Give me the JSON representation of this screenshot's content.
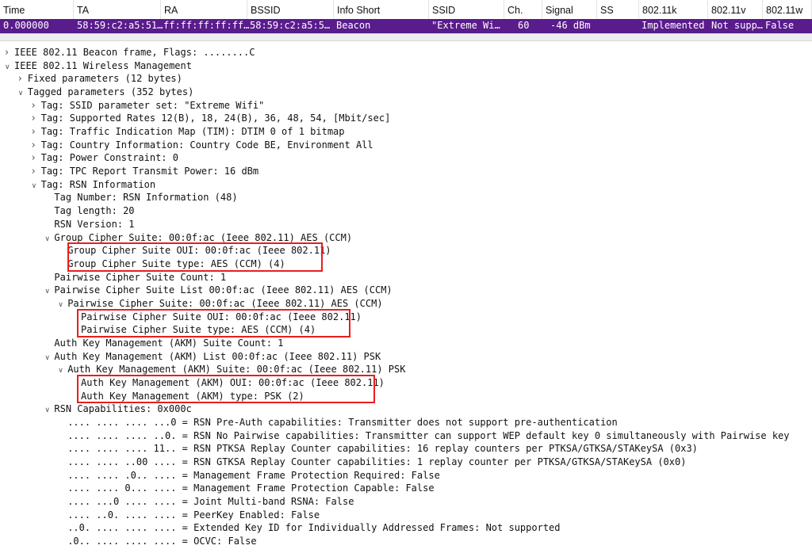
{
  "packet_list": {
    "columns": [
      "Time",
      "TA",
      "RA",
      "BSSID",
      "Info Short",
      "SSID",
      "Ch.",
      "Signal",
      "SS",
      "802.11k",
      "802.11v",
      "802.11w"
    ],
    "selected_row": [
      "0.000000",
      "58:59:c2:a5:51…",
      "ff:ff:ff:ff:ff…",
      "58:59:c2:a5:5…",
      "Beacon",
      "\"Extreme Wi…",
      "60",
      "-46 dBm",
      "",
      "Implemented",
      "Not supp…",
      "False"
    ],
    "selected_color": "#5a1b8d"
  },
  "tree": [
    {
      "level": 0,
      "arrow": "collapsed",
      "text": "IEEE 802.11 Beacon frame, Flags: ........C"
    },
    {
      "level": 0,
      "arrow": "expanded",
      "text": "IEEE 802.11 Wireless Management"
    },
    {
      "level": 1,
      "arrow": "collapsed",
      "text": "Fixed parameters (12 bytes)"
    },
    {
      "level": 1,
      "arrow": "expanded",
      "text": "Tagged parameters (352 bytes)"
    },
    {
      "level": 2,
      "arrow": "collapsed",
      "text": "Tag: SSID parameter set: \"Extreme Wifi\""
    },
    {
      "level": 2,
      "arrow": "collapsed",
      "text": "Tag: Supported Rates 12(B), 18, 24(B), 36, 48, 54, [Mbit/sec]"
    },
    {
      "level": 2,
      "arrow": "collapsed",
      "text": "Tag: Traffic Indication Map (TIM): DTIM 0 of 1 bitmap"
    },
    {
      "level": 2,
      "arrow": "collapsed",
      "text": "Tag: Country Information: Country Code BE, Environment All"
    },
    {
      "level": 2,
      "arrow": "collapsed",
      "text": "Tag: Power Constraint: 0"
    },
    {
      "level": 2,
      "arrow": "collapsed",
      "text": "Tag: TPC Report Transmit Power: 16 dBm"
    },
    {
      "level": 2,
      "arrow": "expanded",
      "text": "Tag: RSN Information"
    },
    {
      "level": 3,
      "arrow": "none",
      "text": "Tag Number: RSN Information (48)"
    },
    {
      "level": 3,
      "arrow": "none",
      "text": "Tag length: 20"
    },
    {
      "level": 3,
      "arrow": "none",
      "text": "RSN Version: 1"
    },
    {
      "level": 3,
      "arrow": "expanded",
      "text": "Group Cipher Suite: 00:0f:ac (Ieee 802.11) AES (CCM)"
    },
    {
      "level": 4,
      "arrow": "none",
      "text": "Group Cipher Suite OUI: 00:0f:ac (Ieee 802.11)"
    },
    {
      "level": 4,
      "arrow": "none",
      "text": "Group Cipher Suite type: AES (CCM) (4)"
    },
    {
      "level": 3,
      "arrow": "none",
      "text": "Pairwise Cipher Suite Count: 1"
    },
    {
      "level": 3,
      "arrow": "expanded",
      "text": "Pairwise Cipher Suite List 00:0f:ac (Ieee 802.11) AES (CCM)"
    },
    {
      "level": 4,
      "arrow": "expanded",
      "text": "Pairwise Cipher Suite: 00:0f:ac (Ieee 802.11) AES (CCM)"
    },
    {
      "level": 5,
      "arrow": "none",
      "text": "Pairwise Cipher Suite OUI: 00:0f:ac (Ieee 802.11)"
    },
    {
      "level": 5,
      "arrow": "none",
      "text": "Pairwise Cipher Suite type: AES (CCM) (4)"
    },
    {
      "level": 3,
      "arrow": "none",
      "text": "Auth Key Management (AKM) Suite Count: 1"
    },
    {
      "level": 3,
      "arrow": "expanded",
      "text": "Auth Key Management (AKM) List 00:0f:ac (Ieee 802.11) PSK"
    },
    {
      "level": 4,
      "arrow": "expanded",
      "text": "Auth Key Management (AKM) Suite: 00:0f:ac (Ieee 802.11) PSK"
    },
    {
      "level": 5,
      "arrow": "none",
      "text": "Auth Key Management (AKM) OUI: 00:0f:ac (Ieee 802.11)"
    },
    {
      "level": 5,
      "arrow": "none",
      "text": "Auth Key Management (AKM) type: PSK (2)"
    },
    {
      "level": 3,
      "arrow": "expanded",
      "text": "RSN Capabilities: 0x000c"
    },
    {
      "level": 4,
      "arrow": "none",
      "text": ".... .... .... ...0 = RSN Pre-Auth capabilities: Transmitter does not support pre-authentication"
    },
    {
      "level": 4,
      "arrow": "none",
      "text": ".... .... .... ..0. = RSN No Pairwise capabilities: Transmitter can support WEP default key 0 simultaneously with Pairwise key"
    },
    {
      "level": 4,
      "arrow": "none",
      "text": ".... .... .... 11.. = RSN PTKSA Replay Counter capabilities: 16 replay counters per PTKSA/GTKSA/STAKeySA (0x3)"
    },
    {
      "level": 4,
      "arrow": "none",
      "text": ".... .... ..00 .... = RSN GTKSA Replay Counter capabilities: 1 replay counter per PTKSA/GTKSA/STAKeySA (0x0)"
    },
    {
      "level": 4,
      "arrow": "none",
      "text": ".... .... .0.. .... = Management Frame Protection Required: False"
    },
    {
      "level": 4,
      "arrow": "none",
      "text": ".... .... 0... .... = Management Frame Protection Capable: False"
    },
    {
      "level": 4,
      "arrow": "none",
      "text": ".... ...0 .... .... = Joint Multi-band RSNA: False"
    },
    {
      "level": 4,
      "arrow": "none",
      "text": ".... ..0. .... .... = PeerKey Enabled: False"
    },
    {
      "level": 4,
      "arrow": "none",
      "text": "..0. .... .... .... = Extended Key ID for Individually Addressed Frames: Not supported"
    },
    {
      "level": 4,
      "arrow": "none",
      "text": ".0.. .... .... .... = OCVC: False"
    }
  ],
  "highlight_color": "#e81e1e"
}
